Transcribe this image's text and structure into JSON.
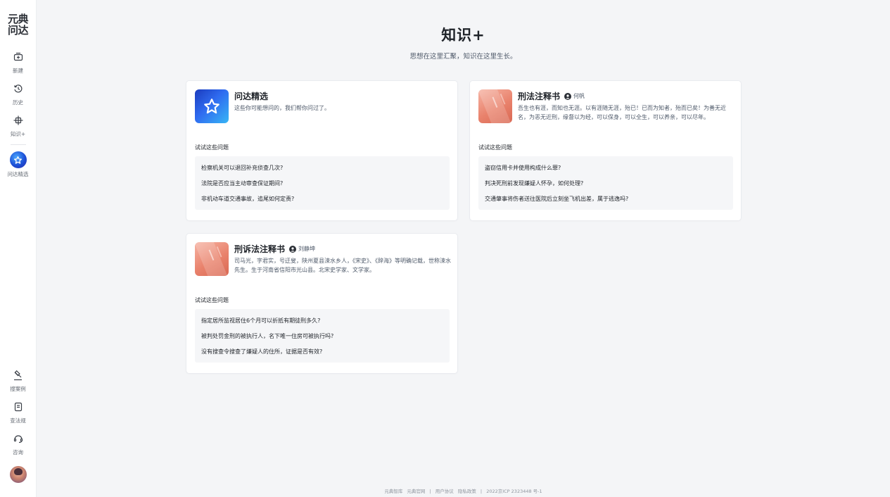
{
  "sidebar": {
    "logo": "元典\n问达",
    "items": [
      {
        "label": "新建",
        "icon": "new-chat-icon"
      },
      {
        "label": "历史",
        "icon": "history-icon"
      },
      {
        "label": "知识+",
        "icon": "knowledge-icon"
      },
      {
        "label": "问达精选",
        "icon": "star-icon"
      }
    ],
    "bottom_items": [
      {
        "label": "搜案例",
        "icon": "gavel-icon"
      },
      {
        "label": "查法规",
        "icon": "document-icon"
      },
      {
        "label": "咨询",
        "icon": "consult-icon"
      }
    ]
  },
  "header": {
    "title": "知识+",
    "subtitle": "思想在这里汇聚，知识在这里生长。"
  },
  "cards": [
    {
      "title": "问达精选",
      "author": "",
      "description": "这些你可能想问的，我们帮你问过了。",
      "try_label": "试试这些问题",
      "questions": [
        "检察机关可以退回补充侦查几次?",
        "法院是否应当主动审查保证期间?",
        "非机动车道交通事故，追尾如何定责?"
      ]
    },
    {
      "title": "刑法注释书",
      "author": "何帆",
      "description": "吾生也有涯，而知也无涯。以有涯随无涯，殆已！已而为知者，殆而已矣！为善无近名，为恶无近刑，缘督以为经，可以保身，可以全生，可以养亲，可以尽年。",
      "try_label": "试试这些问题",
      "questions": [
        "盗窃信用卡并使用构成什么罪?",
        "判决死刑前发现嫌疑人怀孕，如何处理?",
        "交通肇事将伤者送往医院后立刻坐飞机出差，属于逃逸吗?"
      ]
    },
    {
      "title": "刑诉法注释书",
      "author": "刘静坤",
      "description": "司马光，字君实，号迂叟，陕州夏县涑水乡人，《宋史》、《辞海》等明确记载，世称涑水先生。生于河南省信阳市光山县。北宋史学家、文学家。",
      "try_label": "试试这些问题",
      "questions": [
        "指定居所监视居住6个月可以折抵有期徒刑多久?",
        "被判处罚金刑的被执行人，名下唯一住房可被执行吗?",
        "没有搜查令搜查了嫌疑人的住所，证据是否有效?"
      ]
    }
  ],
  "footer": {
    "links": [
      "元典智库",
      "元典官网",
      "|",
      "用户协议",
      "隐私政策",
      "|",
      "2022京ICP 2323448 号-1"
    ]
  },
  "colors": {
    "background": "#f4f5f7",
    "card": "#ffffff",
    "question_box": "#f5f6f8",
    "accent_blue": "#2f6bf0",
    "book_cover": "#e9826c"
  }
}
